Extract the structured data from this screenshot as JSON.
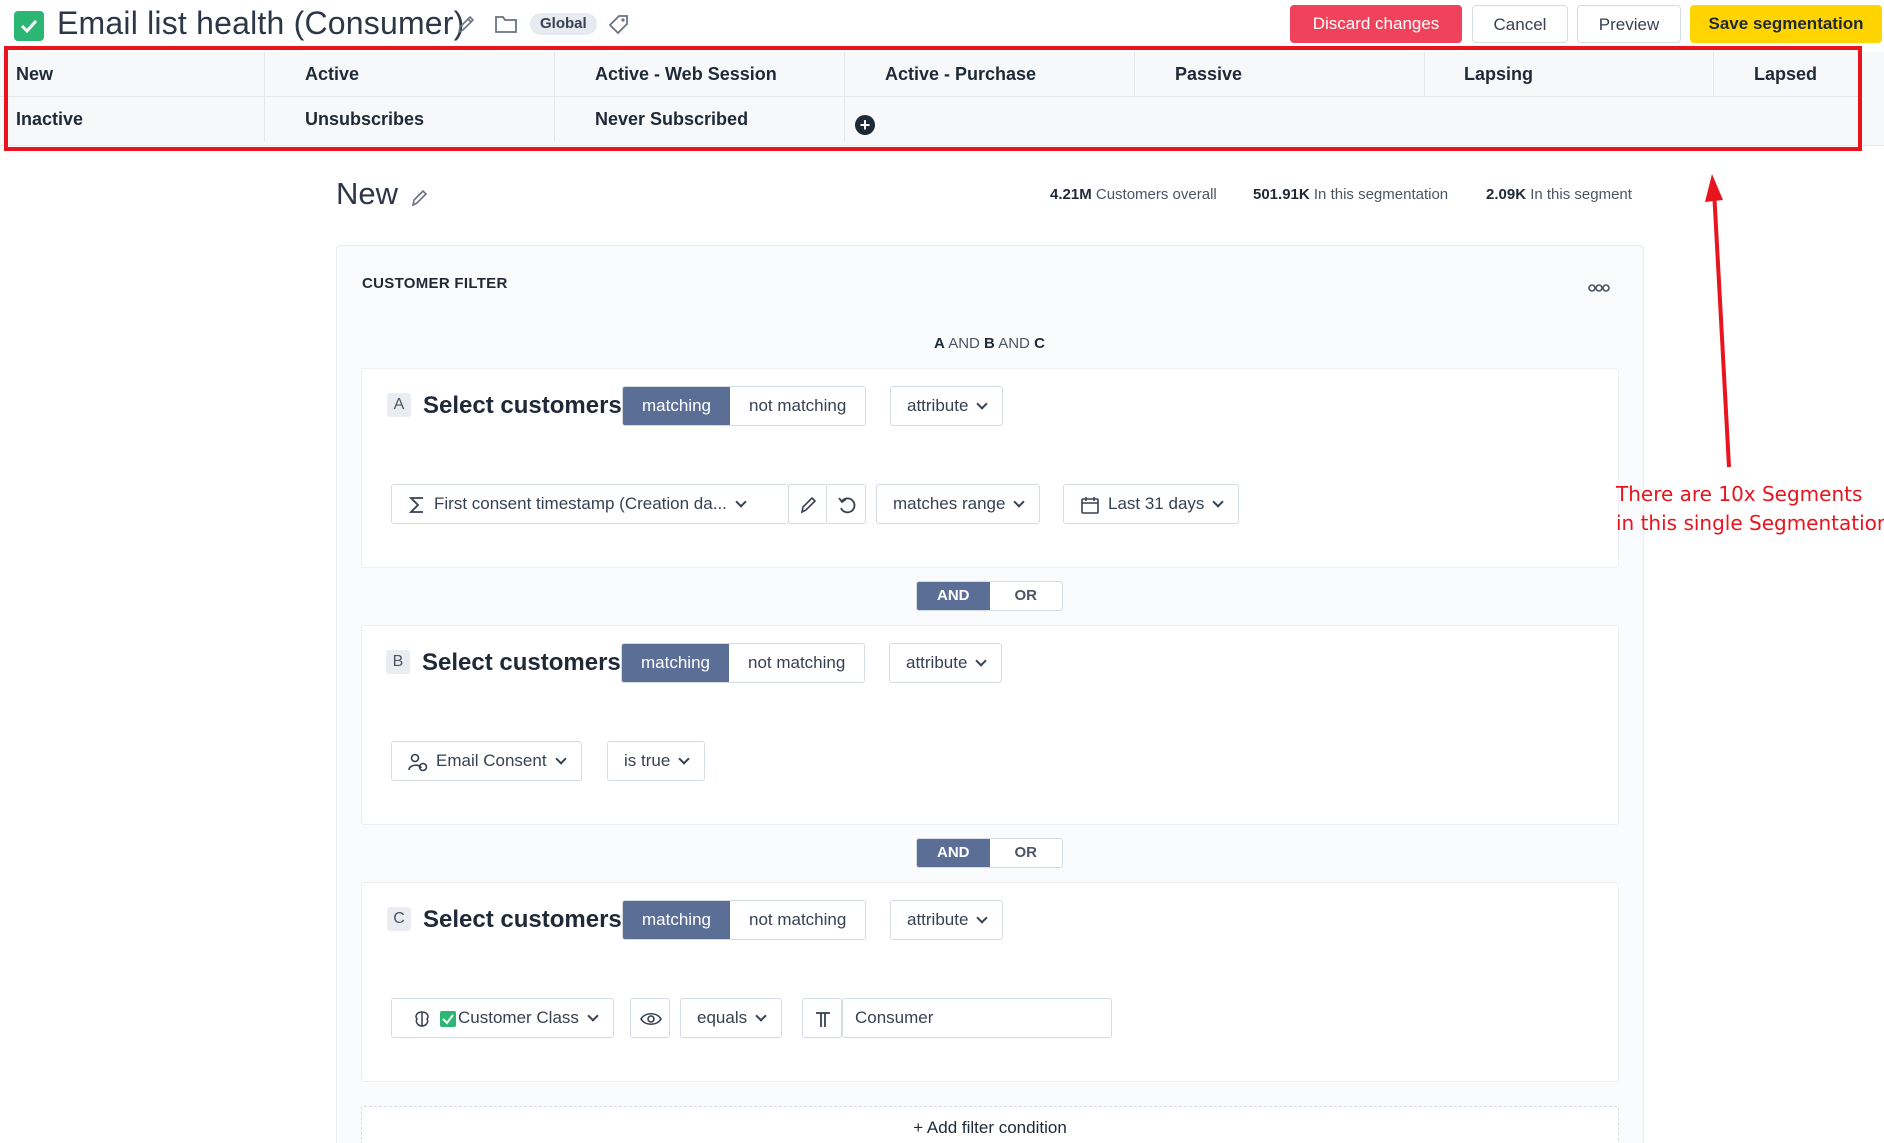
{
  "header": {
    "title": "Email list health (Consumer)",
    "scope_badge": "Global",
    "discard_label": "Discard changes",
    "cancel_label": "Cancel",
    "preview_label": "Preview",
    "save_label": "Save segmentation"
  },
  "segments": {
    "row1": [
      "New",
      "Active",
      "Active - Web Session",
      "Active - Purchase",
      "Passive",
      "Lapsing",
      "Lapsed"
    ],
    "row2": [
      "Inactive",
      "Unsubscribes",
      "Never Subscribed"
    ]
  },
  "segment": {
    "name": "New",
    "stats": {
      "overall_value": "4.21M",
      "overall_label": "Customers overall",
      "segmentation_value": "501.91K",
      "segmentation_label": "In this segmentation",
      "segment_value": "2.09K",
      "segment_label": "In this segment"
    }
  },
  "filter": {
    "title": "CUSTOMER FILTER",
    "logic": {
      "a": "A",
      "and1": "AND",
      "b": "B",
      "and2": "AND",
      "c": "C"
    },
    "select_label": "Select customers",
    "matching_label": "matching",
    "not_matching_label": "not matching",
    "attribute_label": "attribute",
    "and_label": "AND",
    "or_label": "OR",
    "blocks": [
      {
        "letter": "A",
        "property": "First consent timestamp (Creation da...",
        "operator": "matches range",
        "value": "Last 31 days"
      },
      {
        "letter": "B",
        "property": "Email Consent",
        "operator": "is true"
      },
      {
        "letter": "C",
        "property": "Customer Class",
        "operator": "equals",
        "value": "Consumer"
      }
    ],
    "add_condition_label": "+ Add filter condition"
  },
  "annotation": {
    "line1": "There are 10x Segments",
    "line2": "in this single Segmentation",
    "color": "#e8141e"
  },
  "colors": {
    "discard": "#f0425a",
    "save": "#ffd400",
    "toggle_active": "#5b6f96",
    "check": "#2bb673"
  }
}
